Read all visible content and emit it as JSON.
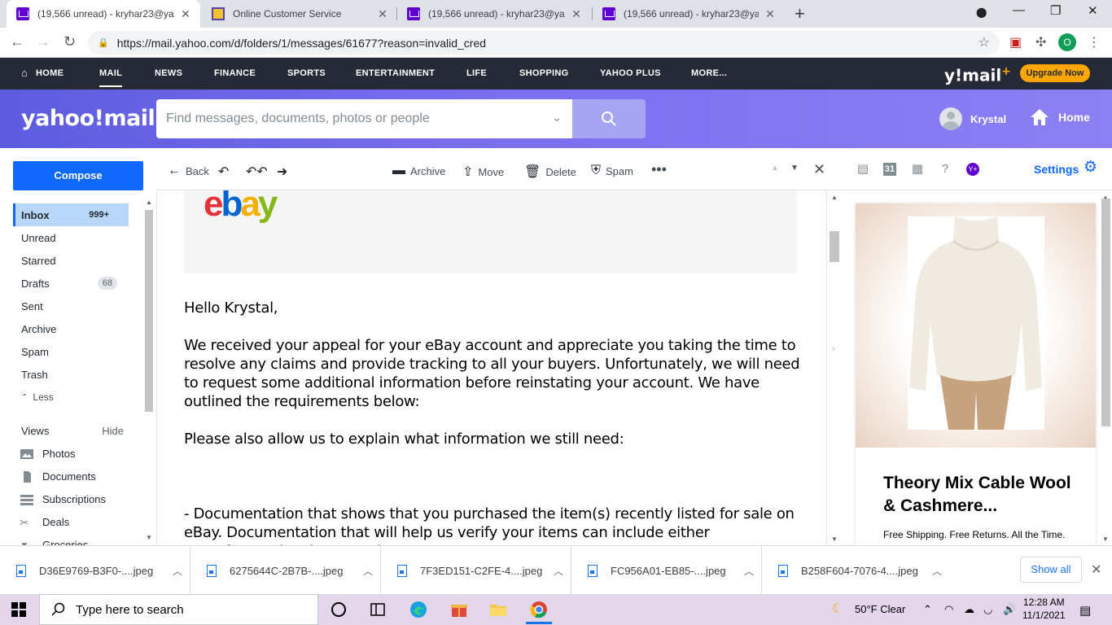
{
  "browser": {
    "tabs": [
      {
        "title": "(19,566 unread) - kryhar23@yaho",
        "active": true
      },
      {
        "title": "Online Customer Service",
        "active": false
      },
      {
        "title": "(19,566 unread) - kryhar23@yaho",
        "active": false
      },
      {
        "title": "(19,566 unread) - kryhar23@yaho",
        "active": false
      }
    ],
    "url": "https://mail.yahoo.com/d/folders/1/messages/61677?reason=invalid_cred",
    "profile_initial": "O"
  },
  "yahoo_nav": {
    "items": [
      "HOME",
      "MAIL",
      "NEWS",
      "FINANCE",
      "SPORTS",
      "ENTERTAINMENT",
      "LIFE",
      "SHOPPING",
      "YAHOO PLUS",
      "MORE..."
    ],
    "logo_small": "y!mail",
    "upgrade_label": "Upgrade Now"
  },
  "header": {
    "logo": "yahoo!mail",
    "search_placeholder": "Find messages, documents, photos or people",
    "user_name": "Krystal",
    "home_label": "Home"
  },
  "sidebar": {
    "compose_label": "Compose",
    "folders": [
      {
        "label": "Inbox",
        "count": "999+"
      },
      {
        "label": "Unread",
        "count": ""
      },
      {
        "label": "Starred",
        "count": ""
      },
      {
        "label": "Drafts",
        "count": "68"
      },
      {
        "label": "Sent",
        "count": ""
      },
      {
        "label": "Archive",
        "count": ""
      },
      {
        "label": "Spam",
        "count": ""
      },
      {
        "label": "Trash",
        "count": ""
      }
    ],
    "less_label": "Less",
    "views_label": "Views",
    "hide_label": "Hide",
    "views": [
      "Photos",
      "Documents",
      "Subscriptions",
      "Deals",
      "Groceries"
    ]
  },
  "message_toolbar": {
    "back": "Back",
    "archive": "Archive",
    "move": "Move",
    "delete": "Delete",
    "spam": "Spam"
  },
  "message": {
    "greeting": "Hello Krystal,",
    "para1": "We received your appeal for your eBay account and appreciate you taking the time to resolve any claims and provide tracking to all your buyers. Unfortunately, we will need to request some additional information before reinstating your account. We have outlined the requirements below:",
    "para2": "Please also allow us to explain what information we still need:",
    "para3": "- Documentation that shows that you purchased the item(s) recently listed for sale on eBay. Documentation that will help us verify your items can include either manufacture invoices, receipts..."
  },
  "right_rail": {
    "settings_label": "Settings",
    "ad_title": "Theory Mix Cable Wool & Cashmere...",
    "ad_sub": "Free Shipping. Free Returns. All the Time."
  },
  "downloads": {
    "files": [
      "D36E9769-B3F0-....jpeg",
      "6275644C-2B7B-....jpeg",
      "7F3ED151-C2FE-4....jpeg",
      "FC956A01-EB85-....jpeg",
      "B258F604-7076-4....jpeg"
    ],
    "show_all": "Show all"
  },
  "taskbar": {
    "search_placeholder": "Type here to search",
    "weather": "50°F  Clear",
    "time": "12:28 AM",
    "date": "11/1/2021"
  }
}
